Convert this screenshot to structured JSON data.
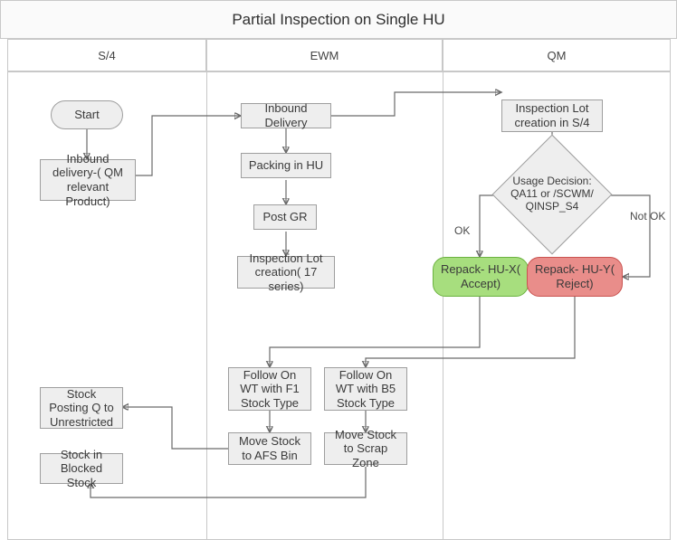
{
  "title": "Partial Inspection on Single HU",
  "lanes": {
    "s4": {
      "header": "S/4"
    },
    "ewm": {
      "header": "EWM"
    },
    "qm": {
      "header": "QM"
    }
  },
  "nodes": {
    "start": "Start",
    "inbound_delivery_qm": "Inbound delivery-( QM relevant Product)",
    "inbound_delivery": "Inbound Delivery",
    "packing_hu": "Packing in HU",
    "post_gr": "Post GR",
    "insp_lot_17": "Inspection Lot creation( 17 series)",
    "follow_on_f1": "Follow On WT with F1 Stock Type",
    "follow_on_b5": "Follow On WT with B5 Stock Type",
    "move_afs": "Move Stock to AFS Bin",
    "move_scrap": "Move Stock to Scrap Zone",
    "insp_lot_s4": "Inspection Lot creation in S/4",
    "usage_decision": "Usage Decision: QA11 or /SCWM/ QINSP_S4",
    "repack_accept": "Repack- HU-X( Accept)",
    "repack_reject": "Repack- HU-Y( Reject)",
    "stock_posting_q": "Stock Posting Q to Unrestricted",
    "stock_blocked": "Stock in Blocked Stock"
  },
  "edges": {
    "ok": "OK",
    "not_ok": "Not OK"
  },
  "colors": {
    "node_bg": "#eeeeee",
    "node_br": "#9e9e9e",
    "accept_bg": "#a7de7e",
    "reject_bg": "#e98d8a",
    "arrow": "#6a6a6a",
    "border": "#c8c8c8"
  },
  "chart_data": {
    "type": "flowchart-swimlane",
    "title": "Partial Inspection on Single HU",
    "lanes": [
      "S/4",
      "EWM",
      "QM"
    ],
    "nodes": [
      {
        "id": "start",
        "lane": "S/4",
        "kind": "terminator",
        "label": "Start"
      },
      {
        "id": "inbound_delivery_qm",
        "lane": "S/4",
        "kind": "process",
        "label": "Inbound delivery-( QM relevant Product)"
      },
      {
        "id": "stock_posting_q",
        "lane": "S/4",
        "kind": "process",
        "label": "Stock Posting Q to Unrestricted"
      },
      {
        "id": "stock_blocked",
        "lane": "S/4",
        "kind": "process",
        "label": "Stock in Blocked Stock"
      },
      {
        "id": "inbound_delivery",
        "lane": "EWM",
        "kind": "process",
        "label": "Inbound Delivery"
      },
      {
        "id": "packing_hu",
        "lane": "EWM",
        "kind": "process",
        "label": "Packing in HU"
      },
      {
        "id": "post_gr",
        "lane": "EWM",
        "kind": "process",
        "label": "Post GR"
      },
      {
        "id": "insp_lot_17",
        "lane": "EWM",
        "kind": "process",
        "label": "Inspection Lot creation( 17 series)"
      },
      {
        "id": "follow_on_f1",
        "lane": "EWM",
        "kind": "process",
        "label": "Follow On WT with F1 Stock Type"
      },
      {
        "id": "follow_on_b5",
        "lane": "EWM",
        "kind": "process",
        "label": "Follow On WT with B5 Stock Type"
      },
      {
        "id": "move_afs",
        "lane": "EWM",
        "kind": "process",
        "label": "Move Stock to AFS Bin"
      },
      {
        "id": "move_scrap",
        "lane": "EWM",
        "kind": "process",
        "label": "Move Stock to Scrap Zone"
      },
      {
        "id": "insp_lot_s4",
        "lane": "QM",
        "kind": "process",
        "label": "Inspection Lot creation in S/4"
      },
      {
        "id": "usage_decision",
        "lane": "QM",
        "kind": "decision",
        "label": "Usage Decision: QA11 or /SCWM/ QINSP_S4"
      },
      {
        "id": "repack_accept",
        "lane": "QM",
        "kind": "process",
        "label": "Repack- HU-X( Accept)",
        "color": "green"
      },
      {
        "id": "repack_reject",
        "lane": "QM",
        "kind": "process",
        "label": "Repack- HU-Y( Reject)",
        "color": "red"
      }
    ],
    "edges": [
      {
        "from": "start",
        "to": "inbound_delivery_qm"
      },
      {
        "from": "inbound_delivery_qm",
        "to": "inbound_delivery"
      },
      {
        "from": "inbound_delivery",
        "to": "packing_hu"
      },
      {
        "from": "packing_hu",
        "to": "post_gr"
      },
      {
        "from": "post_gr",
        "to": "insp_lot_17"
      },
      {
        "from": "inbound_delivery",
        "to": "insp_lot_s4"
      },
      {
        "from": "insp_lot_s4",
        "to": "usage_decision"
      },
      {
        "from": "usage_decision",
        "to": "repack_accept",
        "label": "OK"
      },
      {
        "from": "usage_decision",
        "to": "repack_reject",
        "label": "Not OK"
      },
      {
        "from": "repack_accept",
        "to": "follow_on_f1"
      },
      {
        "from": "repack_reject",
        "to": "follow_on_b5"
      },
      {
        "from": "follow_on_f1",
        "to": "move_afs"
      },
      {
        "from": "follow_on_b5",
        "to": "move_scrap"
      },
      {
        "from": "move_afs",
        "to": "stock_posting_q"
      },
      {
        "from": "move_scrap",
        "to": "stock_blocked"
      }
    ]
  }
}
